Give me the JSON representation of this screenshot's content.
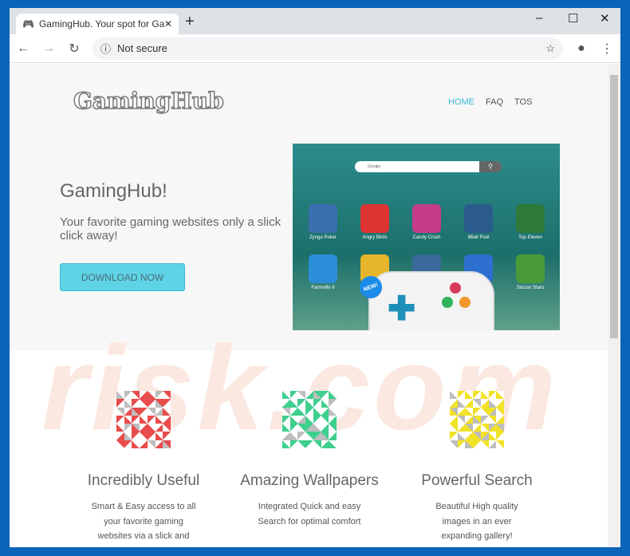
{
  "browser": {
    "tab_title": "GamingHub. Your spot for Gaming",
    "new_tab": "+",
    "security": "Not secure",
    "icons": [
      "gamepad-icon",
      "close-icon",
      "back-icon",
      "forward-icon",
      "reload-icon",
      "info-icon",
      "star-icon",
      "account-icon",
      "menu-icon"
    ]
  },
  "site": {
    "logo": "GamingHub",
    "nav": [
      "HOME",
      "FAQ",
      "TOS"
    ],
    "headline": "GamingHub!",
    "subtitle": "Your favorite gaming websites only a slick click away!",
    "download": "DOWNLOAD NOW",
    "preview": {
      "search_placeholder": "Google",
      "badge": "NEW!",
      "apps": [
        "Zynga Poker",
        "Angry Birds",
        "Candy Crush",
        "8Ball Pool",
        "Top Eleven",
        "Farmville II",
        "",
        "",
        "",
        "Soccer Stars"
      ]
    },
    "features": [
      {
        "title": "Incredibly Useful",
        "desc": "Smart & Easy access to all your favorite gaming websites via a slick and",
        "color": "#e84c4c"
      },
      {
        "title": "Amazing Wallpapers",
        "desc": "Integrated Quick and easy Search for optimal comfort",
        "color": "#3ecf8e"
      },
      {
        "title": "Powerful Search",
        "desc": "Beautiful High quality images in an ever expanding gallery!",
        "color": "#f2e227"
      }
    ]
  }
}
